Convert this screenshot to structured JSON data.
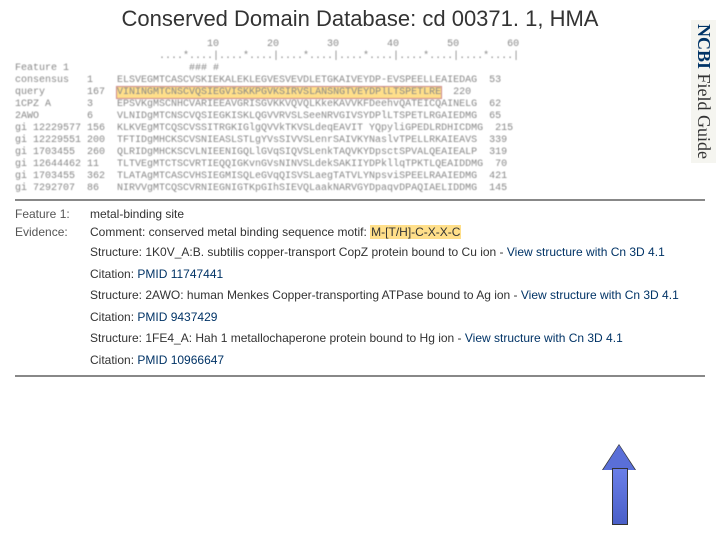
{
  "title": "Conserved Domain Database: cd 00371. 1, HMA",
  "side_tab": {
    "ncbi": "NCBI",
    "fg": " Field Guide"
  },
  "ruler": "                    10        20        30        40        50        60",
  "ruler2": "            ....*....|....*....|....*....|....*....|....*....|....*....|",
  "rows": [
    {
      "label": "Feature 1",
      "pos": "",
      "seq": "            ### #"
    },
    {
      "label": "consensus",
      "pos": "1",
      "seq": "ELSVEGMTCASCVSKIEKALEKLEGVESVEVDLETGKAIVEYDP-EVSPEELLEAIEDAG",
      "end": "53"
    },
    {
      "label": "query",
      "pos": "167",
      "seq": "VININGMTCNSCVQSIEGVISKKPGVKSIRVSLANSNGTVEYDPlLTSPETLRE",
      "end": "220",
      "hl": true
    },
    {
      "label": "1CPZ A",
      "pos": "3",
      "seq": "EPSVKgMSCNHCVARIEEAVGRISGVKKVQVQLKkeKAVVKFDeehvQATEICQAINELG",
      "end": "62"
    },
    {
      "label": "2AWO",
      "pos": "6",
      "seq": "VLNIDgMTCNSCVQSIEGKISKLQGVVRVSLSeeNRVGIVSYDPlLTSPETLRGAIEDMG",
      "end": "65"
    },
    {
      "label": "gi 12229577",
      "pos": "156",
      "seq": "KLKVEgMTCQSCVSSITRGKIGlgQVVkTKVSLdeqEAVIT YQpyliGPEDLRDHICDMG",
      "end": "215"
    },
    {
      "label": "gi 12229551",
      "pos": "200",
      "seq": "TFTIDgMHCKSCVSNIEASLSTLgYVsSIVVSLenrSAIVKYNaslvTPELLRKAIEAVS",
      "end": "339"
    },
    {
      "label": "gi 1703455",
      "pos": "260",
      "seq": "QLRIDgMHCKSCVLNIEENIGQLlGVqSIQVSLenkTAQVKYDpsctSPVALQEAIEALP",
      "end": "319"
    },
    {
      "label": "gi 12644462",
      "pos": "11",
      "seq": "TLTVEgMTCTSCVRTIEQQIGKvnGVsNINVSLdekSAKIIYDPkllqTPKTLQEAIDDMG",
      "end": "70"
    },
    {
      "label": "gi 1703455",
      "pos": "362",
      "seq": "TLATAgMTCASCVHSIEGMISQLeGVqQISVSLaegTATVLYNpsviSPEELRAAIEDMG",
      "end": "421"
    },
    {
      "label": "gi 7292707",
      "pos": "86",
      "seq": "NIRVVgMTCQSCVRNIEGNIGTKpGIhSIEVQLaakNARVGYDpaqvDPAQIAELIDDMG",
      "end": "145"
    }
  ],
  "feature1_label": "Feature 1:",
  "feature1_val": "metal-binding site",
  "evidence_label": "Evidence:",
  "evidence_val_pre": "Comment: conserved metal binding sequence motif: ",
  "motif": "M-[T/H]-C-X-X-C",
  "entries": [
    {
      "struct": "Structure: 1K0V_A:B. subtilis copper-transport CopZ protein bound to Cu ion - ",
      "link": "View structure with Cn 3D 4.1",
      "cite_label": "Citation: ",
      "pmid": "PMID 11747441"
    },
    {
      "struct": "Structure: 2AWO: human Menkes Copper-transporting ATPase bound to Ag ion - ",
      "link": "View structure with Cn 3D 4.1",
      "cite_label": "Citation: ",
      "pmid": "PMID 9437429"
    },
    {
      "struct": "Structure: 1FE4_A: Hah 1 metallochaperone protein bound to Hg ion - ",
      "link": "View structure with Cn 3D 4.1",
      "cite_label": "Citation: ",
      "pmid": "PMID 10966647"
    }
  ]
}
